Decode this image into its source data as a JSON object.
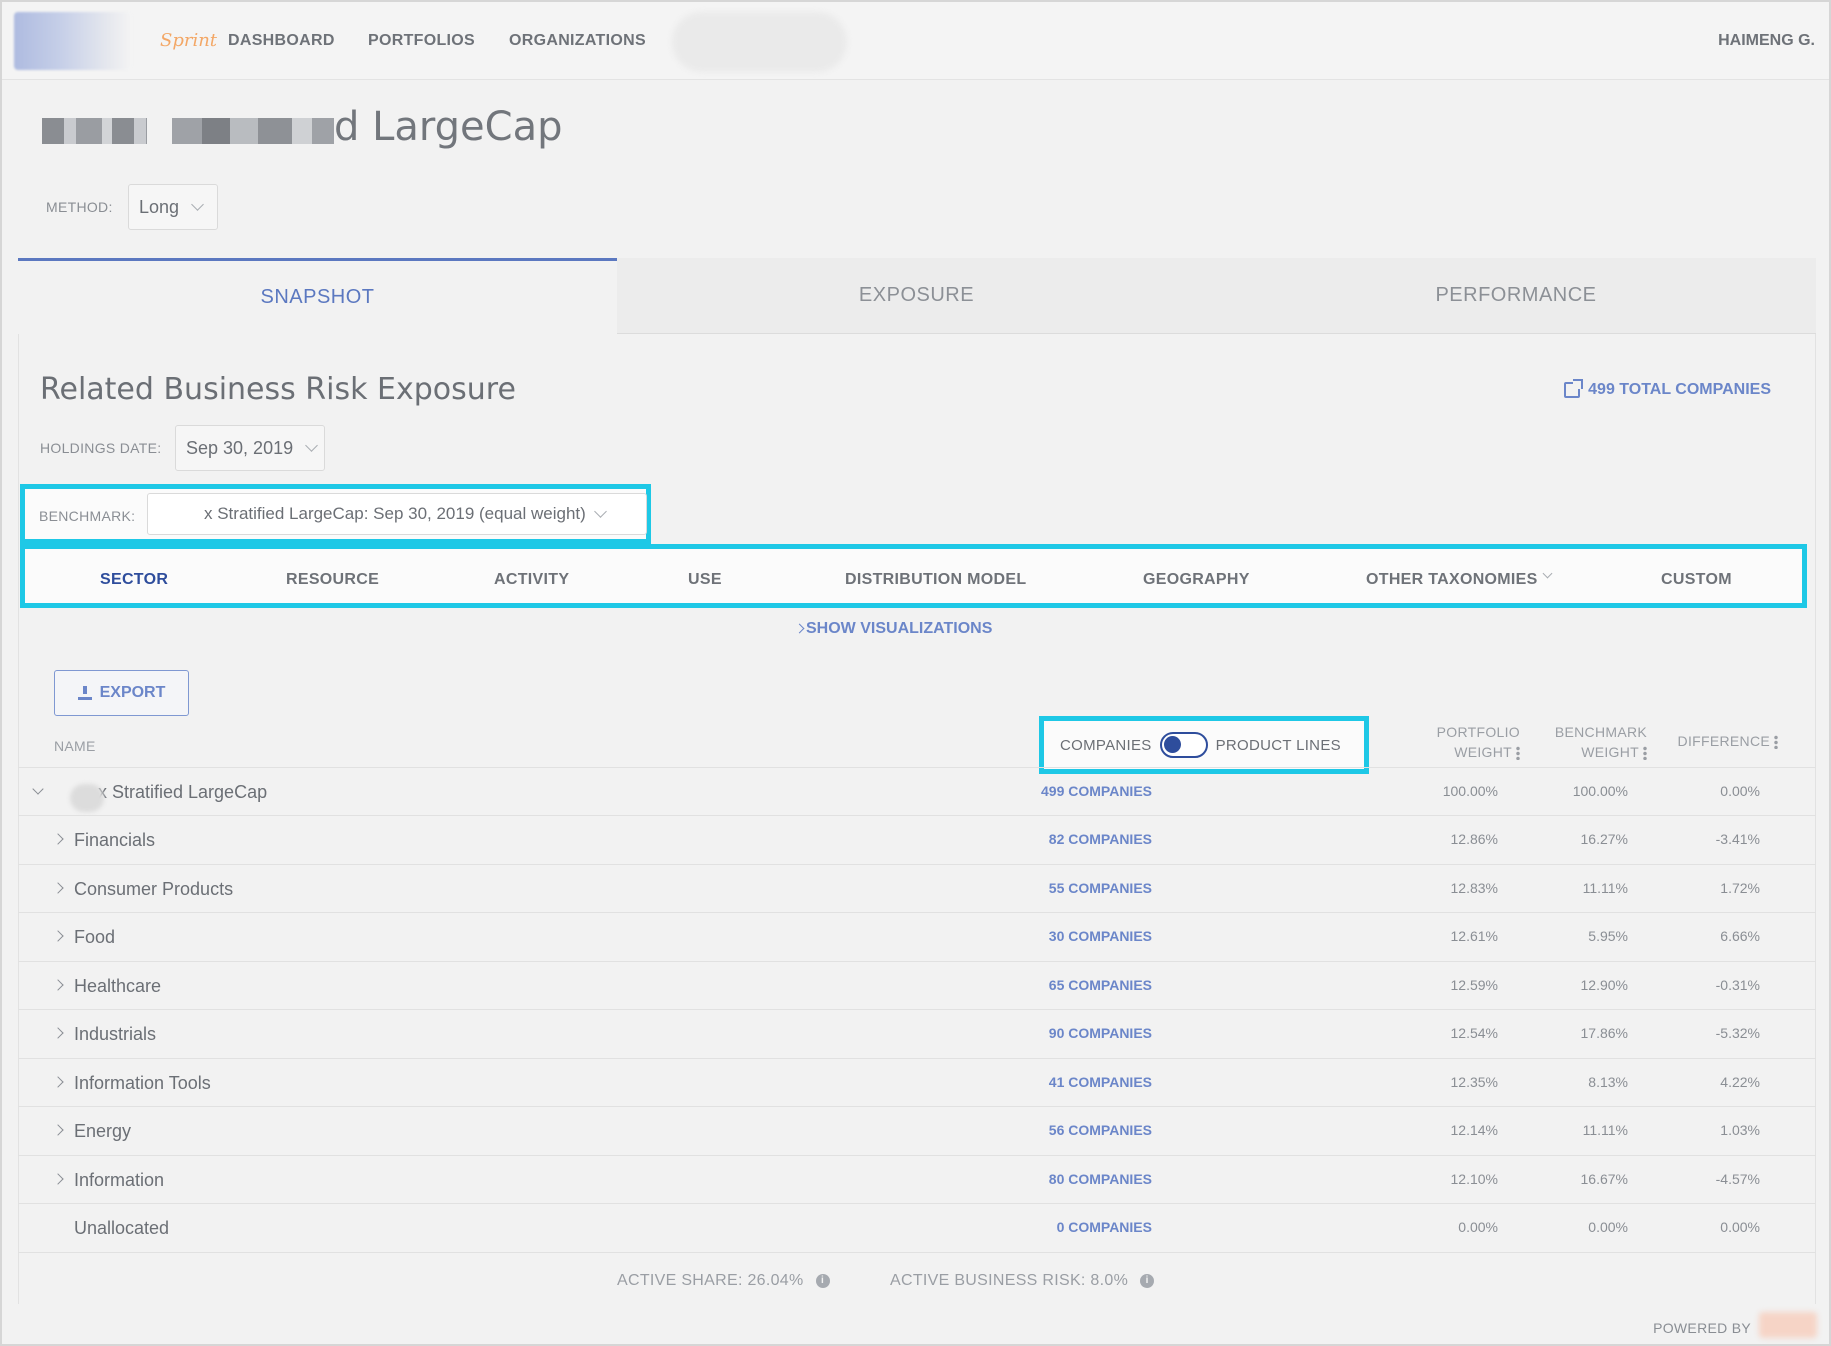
{
  "nav": {
    "brand_label": "Sprint",
    "links": [
      "DASHBOARD",
      "PORTFOLIOS",
      "ORGANIZATIONS"
    ],
    "user": "HAIMENG G."
  },
  "page": {
    "title": "d LargeCap",
    "method_label": "METHOD:",
    "method_value": "Long"
  },
  "tabs": [
    "SNAPSHOT",
    "EXPOSURE",
    "PERFORMANCE"
  ],
  "section": {
    "title": "Related Business Risk Exposure",
    "total_companies": "499 TOTAL COMPANIES",
    "holdings_label": "HOLDINGS DATE:",
    "holdings_value": "Sep 30, 2019",
    "benchmark_label": "BENCHMARK:",
    "benchmark_value": "x Stratified LargeCap: Sep 30, 2019 (equal weight)"
  },
  "subtabs": [
    "SECTOR",
    "RESOURCE",
    "ACTIVITY",
    "USE",
    "DISTRIBUTION MODEL",
    "GEOGRAPHY",
    "OTHER TAXONOMIES",
    "CUSTOM"
  ],
  "show_visualizations": "SHOW VISUALIZATIONS",
  "export_label": "EXPORT",
  "table": {
    "name_header": "NAME",
    "toggle_left": "COMPANIES",
    "toggle_right": "PRODUCT LINES",
    "portfolio_header_1": "PORTFOLIO",
    "portfolio_header_2": "WEIGHT",
    "benchmark_header_1": "BENCHMARK",
    "benchmark_header_2": "WEIGHT",
    "difference_header": "DIFFERENCE",
    "rows": [
      {
        "name": "x Stratified LargeCap",
        "companies": "499 COMPANIES",
        "portfolio": "100.00%",
        "benchmark": "100.00%",
        "difference": "0.00%"
      },
      {
        "name": "Financials",
        "companies": "82 COMPANIES",
        "portfolio": "12.86%",
        "benchmark": "16.27%",
        "difference": "-3.41%"
      },
      {
        "name": "Consumer Products",
        "companies": "55 COMPANIES",
        "portfolio": "12.83%",
        "benchmark": "11.11%",
        "difference": "1.72%"
      },
      {
        "name": "Food",
        "companies": "30 COMPANIES",
        "portfolio": "12.61%",
        "benchmark": "5.95%",
        "difference": "6.66%"
      },
      {
        "name": "Healthcare",
        "companies": "65 COMPANIES",
        "portfolio": "12.59%",
        "benchmark": "12.90%",
        "difference": "-0.31%"
      },
      {
        "name": "Industrials",
        "companies": "90 COMPANIES",
        "portfolio": "12.54%",
        "benchmark": "17.86%",
        "difference": "-5.32%"
      },
      {
        "name": "Information Tools",
        "companies": "41 COMPANIES",
        "portfolio": "12.35%",
        "benchmark": "8.13%",
        "difference": "4.22%"
      },
      {
        "name": "Energy",
        "companies": "56 COMPANIES",
        "portfolio": "12.14%",
        "benchmark": "11.11%",
        "difference": "1.03%"
      },
      {
        "name": "Information",
        "companies": "80 COMPANIES",
        "portfolio": "12.10%",
        "benchmark": "16.67%",
        "difference": "-4.57%"
      },
      {
        "name": "Unallocated",
        "companies": "0 COMPANIES",
        "portfolio": "0.00%",
        "benchmark": "0.00%",
        "difference": "0.00%"
      }
    ]
  },
  "metrics": {
    "active_share": "ACTIVE SHARE: 26.04%",
    "active_business_risk": "ACTIVE BUSINESS RISK: 8.0%"
  },
  "footer": {
    "powered_by": "POWERED BY"
  },
  "colors": {
    "accent": "#5b78c0",
    "highlight": "#1ec8e6",
    "link": "#6b86c9",
    "active_dark": "#2e4d9c"
  }
}
